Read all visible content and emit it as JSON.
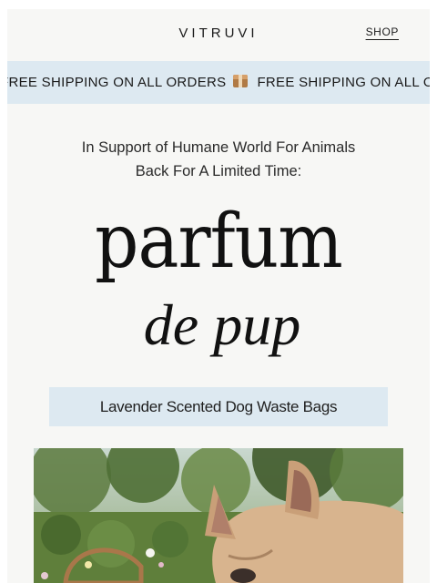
{
  "header": {
    "brand": "VITRUVI",
    "shop_label": "SHOP"
  },
  "ticker": {
    "items": [
      "FREE SHIPPING ON ALL ORDERS",
      "FREE SHIPPING ON ALL ORDERS"
    ],
    "icon": "package-icon"
  },
  "intro": {
    "line1": "In Support of Humane World For Animals",
    "line2": "Back For A Limited Time:"
  },
  "headline": {
    "main": "parfum",
    "sub": "de pup"
  },
  "product_label": "Lavender Scented Dog Waste Bags",
  "photo": {
    "subject": "dog-photo",
    "colors": {
      "foliage": "#6f8a4c",
      "dog": "#d8b48e",
      "basket": "#a9774a"
    }
  },
  "colors": {
    "banner": "#dde9f1",
    "background": "#f7f7f5",
    "text": "#1a1a1a"
  }
}
